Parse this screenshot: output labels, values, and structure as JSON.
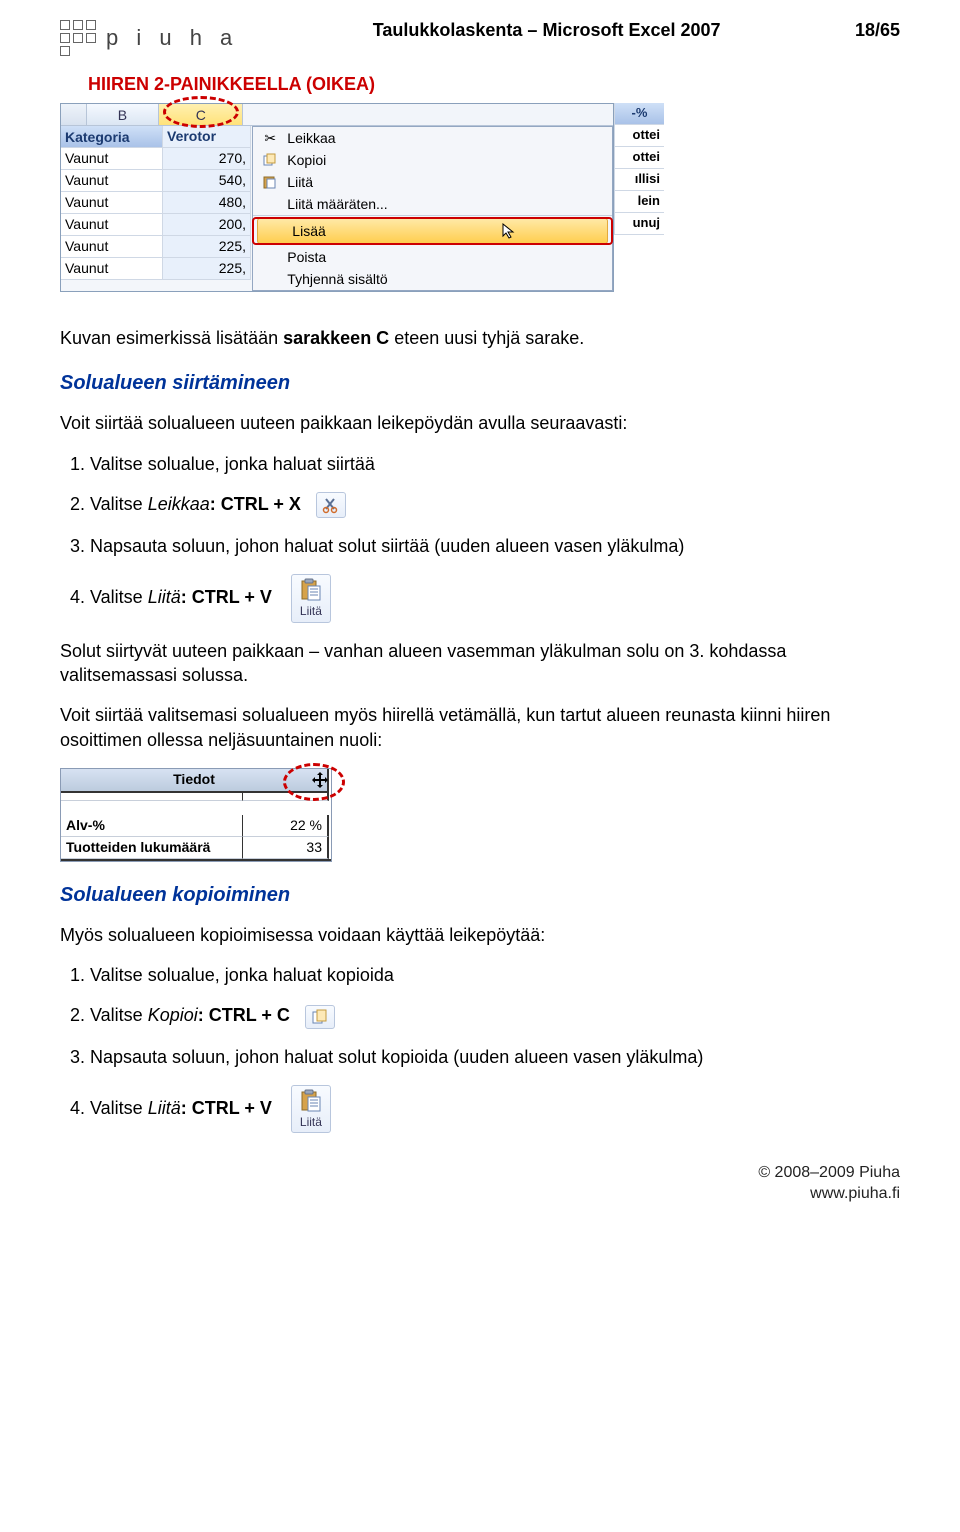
{
  "header": {
    "logo_text": "p i u h a",
    "doc_title": "Taulukkolaskenta – Microsoft Excel 2007",
    "page_num": "18/65"
  },
  "red_label": "HIIREN 2-PAINIKKEELLA (OIKEA)",
  "excel1": {
    "col_b": "B",
    "col_c": "C",
    "header_b": "Kategoria",
    "header_c": "Verotor",
    "rows": [
      {
        "b": "Vaunut",
        "c": "270,"
      },
      {
        "b": "Vaunut",
        "c": "540,"
      },
      {
        "b": "Vaunut",
        "c": "480,"
      },
      {
        "b": "Vaunut",
        "c": "200,"
      },
      {
        "b": "Vaunut",
        "c": "225,"
      },
      {
        "b": "Vaunut",
        "c": "225,"
      }
    ],
    "menu": {
      "cut": "Leikkaa",
      "copy": "Kopioi",
      "paste": "Liitä",
      "paste_special": "Liitä määräten...",
      "insert": "Lisää",
      "delete": "Poista",
      "clear": "Tyhjennä sisältö"
    },
    "right_frag": [
      "-%",
      "ottei",
      "ottei",
      "ıllisi",
      "lein",
      "unuj"
    ]
  },
  "para1": "Kuvan esimerkissä lisätään sarakkeen C eteen uusi tyhjä sarake.",
  "section1_title": "Solualueen siirtämineen",
  "para2": "Voit siirtää solualueen uuteen paikkaan leikepöydän avulla seuraavasti:",
  "steps1": {
    "s1": "Valitse solualue, jonka haluat siirtää",
    "s2_pre": "Valitse ",
    "s2_em": "Leikkaa",
    "s2_post": ": CTRL + X",
    "s3": "Napsauta soluun, johon haluat solut siirtää (uuden alueen vasen yläkulma)",
    "s4_pre": "Valitse ",
    "s4_em": "Liitä",
    "s4_post": ": CTRL + V",
    "paste_label": "Liitä"
  },
  "para3": "Solut siirtyvät uuteen paikkaan – vanhan alueen vasemman yläkulman solu on 3. kohdassa valitsemassasi solussa.",
  "para4": "Voit siirtää valitsemasi solualueen myös hiirellä vetämällä, kun tartut alueen reunasta kiinni hiiren osoittimen ollessa neljäsuuntainen nuoli:",
  "excel2": {
    "title": "Tiedot",
    "rows": [
      {
        "label": "Alv-%",
        "val": "22 %"
      },
      {
        "label": "Tuotteiden lukumäärä",
        "val": "33"
      }
    ]
  },
  "section2_title": "Solualueen kopioiminen",
  "para5": "Myös solualueen kopioimisessa voidaan käyttää leikepöytää:",
  "steps2": {
    "s1": "Valitse solualue, jonka haluat kopioida",
    "s2_pre": "Valitse ",
    "s2_em": "Kopioi",
    "s2_post": ": CTRL + C",
    "s3": "Napsauta soluun, johon haluat solut kopioida (uuden alueen vasen yläkulma)",
    "s4_pre": "Valitse ",
    "s4_em": "Liitä",
    "s4_post": ": CTRL + V",
    "paste_label": "Liitä"
  },
  "footer": {
    "line1": "© 2008–2009 Piuha",
    "line2": "www.piuha.fi"
  }
}
